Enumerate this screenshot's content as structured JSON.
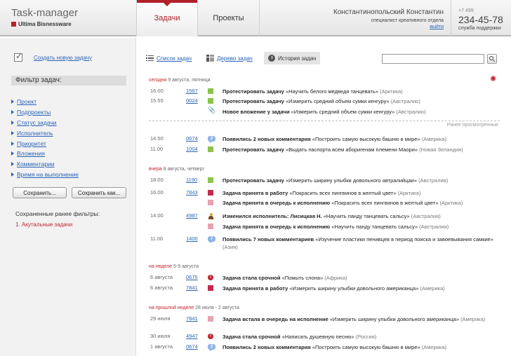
{
  "app": {
    "title": "Task-manager",
    "subtitle": "Ultima Bisnessware"
  },
  "nav": {
    "tabs": [
      {
        "label": "Задачи",
        "active": true
      },
      {
        "label": "Проекты",
        "active": false
      }
    ]
  },
  "user": {
    "name": "Константинопольский Константин",
    "role": "специалист креативного отдела",
    "logout": "выйти"
  },
  "support": {
    "code": "+7 499",
    "phone": "234-45-78",
    "label": "служба поддержки"
  },
  "sidebar": {
    "create_link": "Создать новую задачу",
    "filter_title": "Фильтр задач:",
    "filters": [
      "Проект",
      "Подпроекты",
      "Статус задачи",
      "Исполнитель",
      "Приоритет",
      "Вложения",
      "Комментарии",
      "Время на выполнение"
    ],
    "save_button": "Сохранить...",
    "save_as_button": "Сохранить как...",
    "saved_title": "Сохраненные ранее фильтры:",
    "saved_filters": [
      "1. Акутальные задачи"
    ]
  },
  "toolbar": {
    "list_view": "Список задач",
    "tree_view": "Дерево задач",
    "history": "История задач",
    "search_placeholder": ""
  },
  "colors": {
    "accent": "#b2202a",
    "link": "#2a63b8",
    "done": "#8cc34b",
    "accepted": "#c42a4e",
    "queued": "#e6a3b1",
    "comments": "#8fb5e6"
  },
  "feed": {
    "seen_label": "Ранее просмотренные",
    "sections": [
      {
        "label": "сегодня",
        "sub": "9 августа, пятница"
      },
      {
        "label": "вчера",
        "sub": "8 августа, четверг"
      },
      {
        "label": "на неделе",
        "sub": "5-9 августа"
      },
      {
        "label": "на прошлой неделе",
        "sub": "28 июля - 2 августа"
      }
    ],
    "rows": [
      {
        "date": "16.00",
        "num": "1567",
        "marker": "done",
        "action": "Протестировать задачу",
        "task": "«Научить белого медведя танцевать»",
        "region": "(Арктика)"
      },
      {
        "date": "15.55",
        "num": "0024",
        "marker": "done",
        "action": "Протестировать задачу",
        "task": "«Измерить средний объем сумки кенгуру»",
        "region": "(Австралио)"
      },
      {
        "date": "",
        "num": "",
        "marker": "attachment",
        "action": "Новое вложение у задачи",
        "task": "«Измерить средний объем сумки кенгуру»",
        "region": "(Австралио)"
      },
      {
        "date": "14.50",
        "num": "0674",
        "marker": "comments",
        "badge": "2",
        "action": "Появились 2 новых комментария",
        "task": "«Построить самую высокую башню в мире»",
        "region": "(Америка)"
      },
      {
        "date": "11.00",
        "num": "1004",
        "marker": "done",
        "action": "Протестировать задачу",
        "task": "«Выдать паспорта всем аборигенам племени Маори»",
        "region": "(Новая Зеландия)"
      },
      {
        "date": "18.00",
        "num": "1190",
        "marker": "done",
        "action": "Протестировать задачу",
        "task": "«Измерить ширину улыбки довольного автралийцаи»",
        "region": "(Австралия)"
      },
      {
        "date": "16.00",
        "num": "7843",
        "marker": "accepted",
        "action": "Задача принята в работу",
        "task": "«Покрасить всех пингвинов в желтый цвет»",
        "region": "(Арктика)"
      },
      {
        "date": "",
        "num": "",
        "marker": "queued",
        "action": "Задача принята в очередь к исполнению",
        "task": "«Покрасить всех пингвинов в желтый цвет»",
        "region": "(Арктика)"
      },
      {
        "date": "14.00",
        "num": "4987",
        "marker": "person",
        "action": "Изменился исполнитель: Лисицкая Н.",
        "task": "«Научить панду танцевать сальсу»",
        "region": "(Австралия)"
      },
      {
        "date": "",
        "num": "",
        "marker": "queued",
        "action": "Задача принята в очередь к исполнению",
        "task": "«Научить панду танцевать сальсу»",
        "region": "(Австралия)"
      },
      {
        "date": "11.00",
        "num": "1400",
        "marker": "comments",
        "badge": "7",
        "action": "Появились 7 новых комментариев",
        "task": "«Изучение пластики пенивцев в период поиска и завоевывания самкие»",
        "region": "(Азия)"
      },
      {
        "date": "6 августа",
        "num": "0675",
        "marker": "urgent",
        "action": "Задача стала срочной",
        "task": "«Помыть слона»",
        "region": "(Африка)"
      },
      {
        "date": "6 августа",
        "num": "7841",
        "marker": "accepted",
        "action": "Задача принята в работу",
        "task": "«Измерить ширину улыбки довольного американца»",
        "region": "(Америка)"
      },
      {
        "date": "29 июля",
        "num": "7841",
        "marker": "queued",
        "action": "Задача встала в очередь на исполнение",
        "task": "«Измерить ширину улыбки довольного американца»",
        "region": "(Америка)"
      },
      {
        "date": "30 июля",
        "num": "4947",
        "marker": "urgent",
        "action": "Задача стала срочной",
        "task": "«Написать душевную песню»",
        "region": "(Россия)"
      },
      {
        "date": "1 августа",
        "num": "0674",
        "marker": "comments",
        "badge": "2",
        "action": "Появились 2 новых комментария",
        "task": "«Построить самую высокую башню в мире»",
        "region": "(Америка)"
      }
    ]
  }
}
